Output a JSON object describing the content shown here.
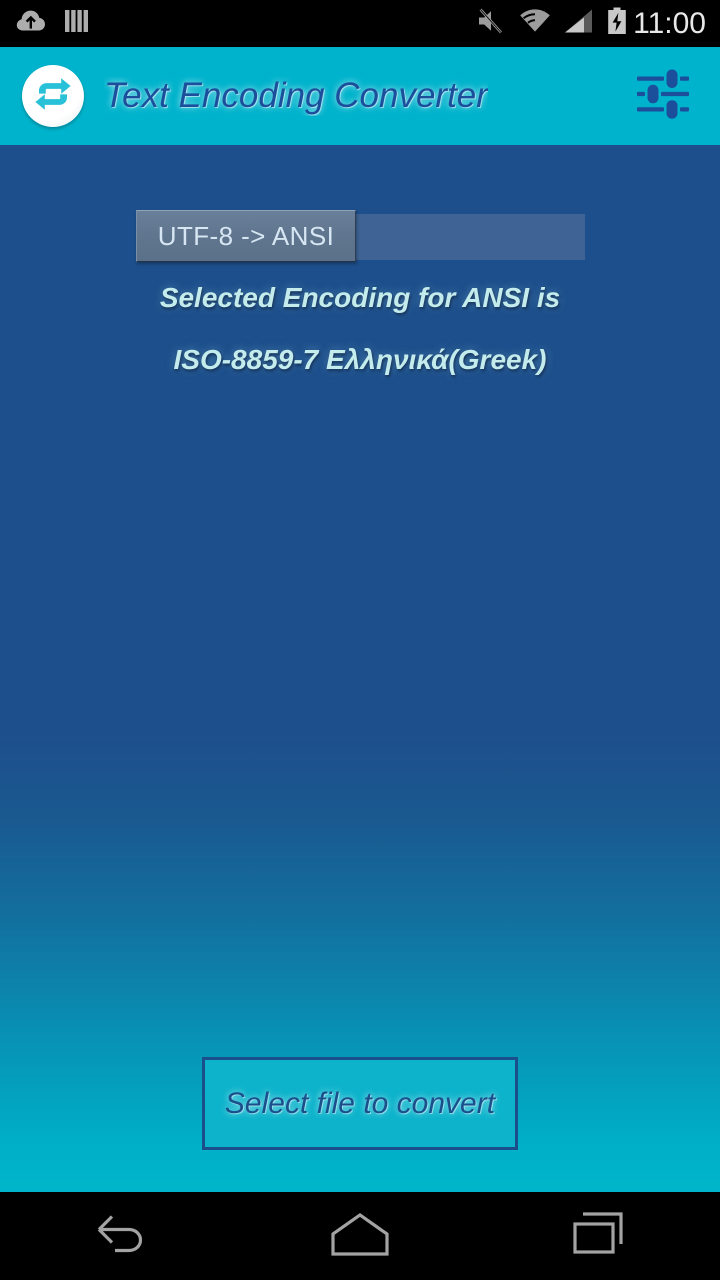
{
  "status_bar": {
    "time": "11:00",
    "left_icons": [
      {
        "name": "cloud-upload-icon"
      },
      {
        "name": "barcode-icon"
      }
    ],
    "right_icons": [
      {
        "name": "volume-muted-icon"
      },
      {
        "name": "wifi-icon"
      },
      {
        "name": "cellular-signal-icon"
      },
      {
        "name": "battery-charging-icon"
      }
    ]
  },
  "app_bar": {
    "logo_icon": "swap-arrows-icon",
    "title": "Text Encoding Converter",
    "settings_icon": "sliders-settings-icon",
    "background_color": "#00b3cc",
    "title_color": "#1b4f9c"
  },
  "main": {
    "encoding_direction": {
      "selected_label": "UTF-8 -> ANSI",
      "chip_color": "#60768f",
      "track_color": "#3f6395"
    },
    "info_line_1": "Selected Encoding for ANSI is",
    "info_line_2": "ISO-8859-7 Ελληνικά(Greek)",
    "info_text_color": "#c5ecec",
    "select_file_button": {
      "label": "Select file to convert",
      "fill_color": "#0db3cb",
      "border_color": "#1b4f8c"
    },
    "background_top_color": "#1d4f8c",
    "background_bottom_color": "#00b5cb"
  },
  "nav_bar": {
    "buttons": [
      {
        "name": "back-button",
        "icon": "back-arrow-icon"
      },
      {
        "name": "home-button",
        "icon": "home-icon"
      },
      {
        "name": "recents-button",
        "icon": "recents-icon"
      }
    ]
  }
}
